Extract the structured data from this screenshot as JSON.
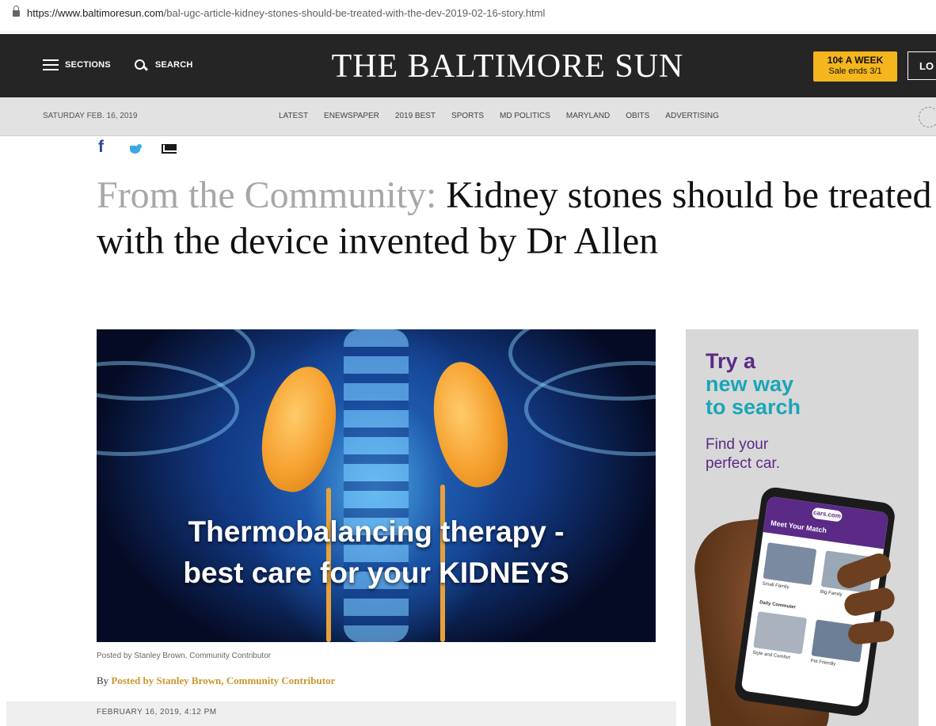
{
  "browser": {
    "url_host": "https://www.baltimoresun.com",
    "url_path": "/bal-ugc-article-kidney-stones-should-be-treated-with-the-dev-2019-02-16-story.html"
  },
  "masthead": {
    "sections_label": "SECTIONS",
    "search_label": "SEARCH",
    "brand": "THE BALTIMORE SUN",
    "promo_line1": "10¢ A WEEK",
    "promo_line2": "Sale ends 3/1",
    "login_label": "LO"
  },
  "nav": {
    "date": "SATURDAY FEB. 16, 2019",
    "links": [
      "LATEST",
      "ENEWSPAPER",
      "2019 BEST",
      "SPORTS",
      "MD POLITICS",
      "MARYLAND",
      "OBITS",
      "ADVERTISING"
    ]
  },
  "article": {
    "kicker": "From the Community:",
    "title": "Kidney stones should be treated with the device invented by Dr Allen",
    "image_caption_line1": "Thermobalancing therapy -",
    "image_caption_line2": "best care for your KIDNEYS",
    "image_credit": "Posted by Stanley Brown, Community Contributor",
    "byline_prefix": "By",
    "byline_author": "Posted by Stanley Brown, Community Contributor",
    "dateline": "FEBRUARY 16, 2019, 4:12 PM"
  },
  "ad": {
    "line1": "Try a",
    "line2": "new way",
    "line3": "to search",
    "sub1": "Find your",
    "sub2": "perfect car.",
    "phone_logo": "cars.com",
    "phone_heading": "Meet Your Match",
    "card1": "Small Family",
    "card2": "Big Family",
    "card3": "Daily Commuter",
    "card4": "Style and Comfort",
    "card5": "Pet Friendly"
  },
  "colors": {
    "masthead_bg": "#252525",
    "promo_bg": "#f4b51d",
    "byline_link": "#c9962d",
    "ad_purple": "#5a2a86",
    "ad_teal": "#1aa6b7"
  }
}
